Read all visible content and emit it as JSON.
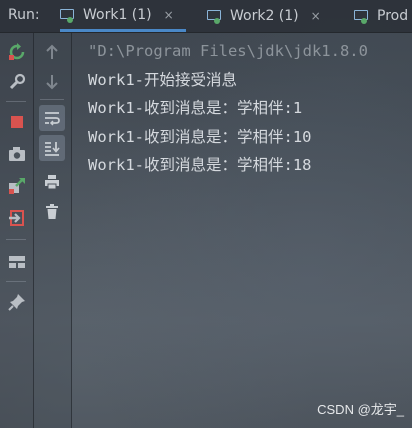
{
  "run_panel": {
    "label": "Run:",
    "tabs": [
      {
        "label": "Work1 (1)",
        "active": true,
        "closable": true
      },
      {
        "label": "Work2 (1)",
        "active": false,
        "closable": true
      },
      {
        "label": "Prod",
        "active": false,
        "closable": false
      }
    ],
    "close_glyph": "×"
  },
  "left_toolbar": {
    "icons": [
      "rerun-icon",
      "wrench-icon",
      "stop-icon",
      "camera-icon",
      "restore-layout-icon",
      "exit-icon",
      "layout-icon",
      "pin-icon"
    ]
  },
  "console_toolbar": {
    "icons": [
      "arrow-up-icon",
      "arrow-down-icon",
      "soft-wrap-icon",
      "scroll-to-end-icon",
      "print-icon",
      "trash-icon"
    ]
  },
  "console": {
    "lines": [
      {
        "text": "\"D:\\Program Files\\jdk\\jdk1.8.0",
        "type": "command"
      },
      {
        "text": "Work1-开始接受消息",
        "type": "output"
      },
      {
        "text": "Work1-收到消息是：学相伴:1",
        "type": "output"
      },
      {
        "text": "Work1-收到消息是：学相伴:10",
        "type": "output"
      },
      {
        "text": "Work1-收到消息是：学相伴:18",
        "type": "output"
      }
    ]
  },
  "watermark": "CSDN @龙宇_",
  "colors": {
    "accent": "#4a88c7",
    "running_dot": "#59a869",
    "stop": "#d9534f",
    "rerun": "#59a869"
  }
}
